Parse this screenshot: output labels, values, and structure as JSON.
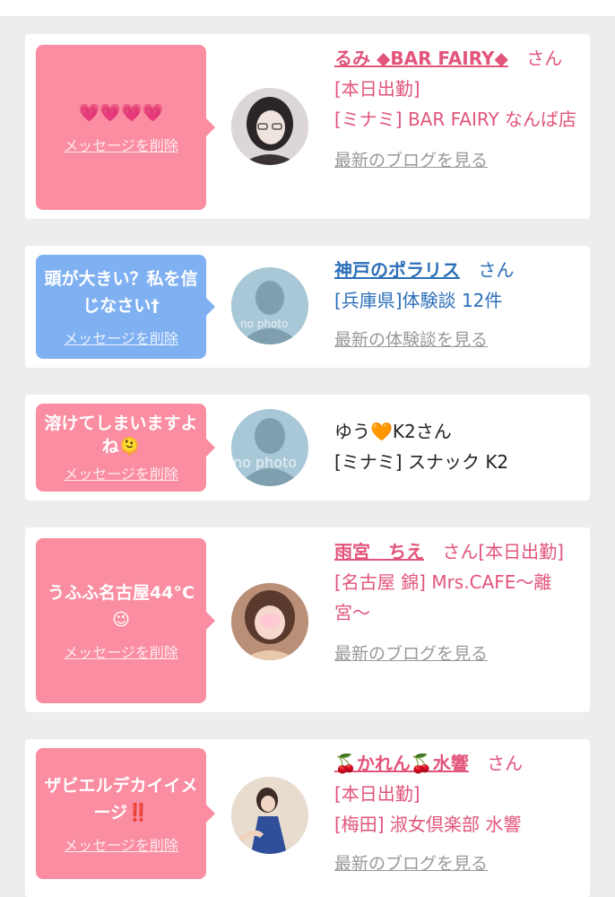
{
  "cards": [
    {
      "message": "💗💗💗💗",
      "delete_label": "メッセージを削除",
      "name": "るみ ◆BAR FAIRY◆",
      "suffix": "さん",
      "line1": "[本日出勤]",
      "line2": "[ミナミ] BAR FAIRY なんば店",
      "blog": "最新のブログを見る"
    },
    {
      "message": "頭が大きい？私を信じなさい†",
      "delete_label": "メッセージを削除",
      "name": "神戸のポラリス",
      "suffix": "さん",
      "line1": "[兵庫県]体験談 12件",
      "blog": "最新の体験談を見る",
      "avatar_text": "no photo"
    },
    {
      "message": "溶けてしまいますよね🫠",
      "delete_label": "メッセージを削除",
      "name": "ゆう🧡K2さん",
      "line1": "[ミナミ] スナック K2",
      "avatar_text": "no photo"
    },
    {
      "message": "うふふ名古屋44°C😉",
      "delete_label": "メッセージを削除",
      "name": "雨宮　ちえ",
      "suffix": "さん[本日出勤]",
      "line2": "[名古屋 錦] Mrs.CAFE〜離宮〜",
      "blog": "最新のブログを見る"
    },
    {
      "message": "ザビエルデカイイメージ‼️",
      "delete_label": "メッセージを削除",
      "name": "🍒かれん🍒水響",
      "suffix": "さん",
      "line1": "[本日出勤]",
      "line2": "[梅田] 淑女倶楽部 水響",
      "blog": "最新のブログを見る"
    }
  ],
  "colors": {
    "pink": "#fa8da1",
    "blue": "#7fb0f2",
    "name_pink": "#e2547a",
    "name_blue": "#2c6fb8"
  }
}
